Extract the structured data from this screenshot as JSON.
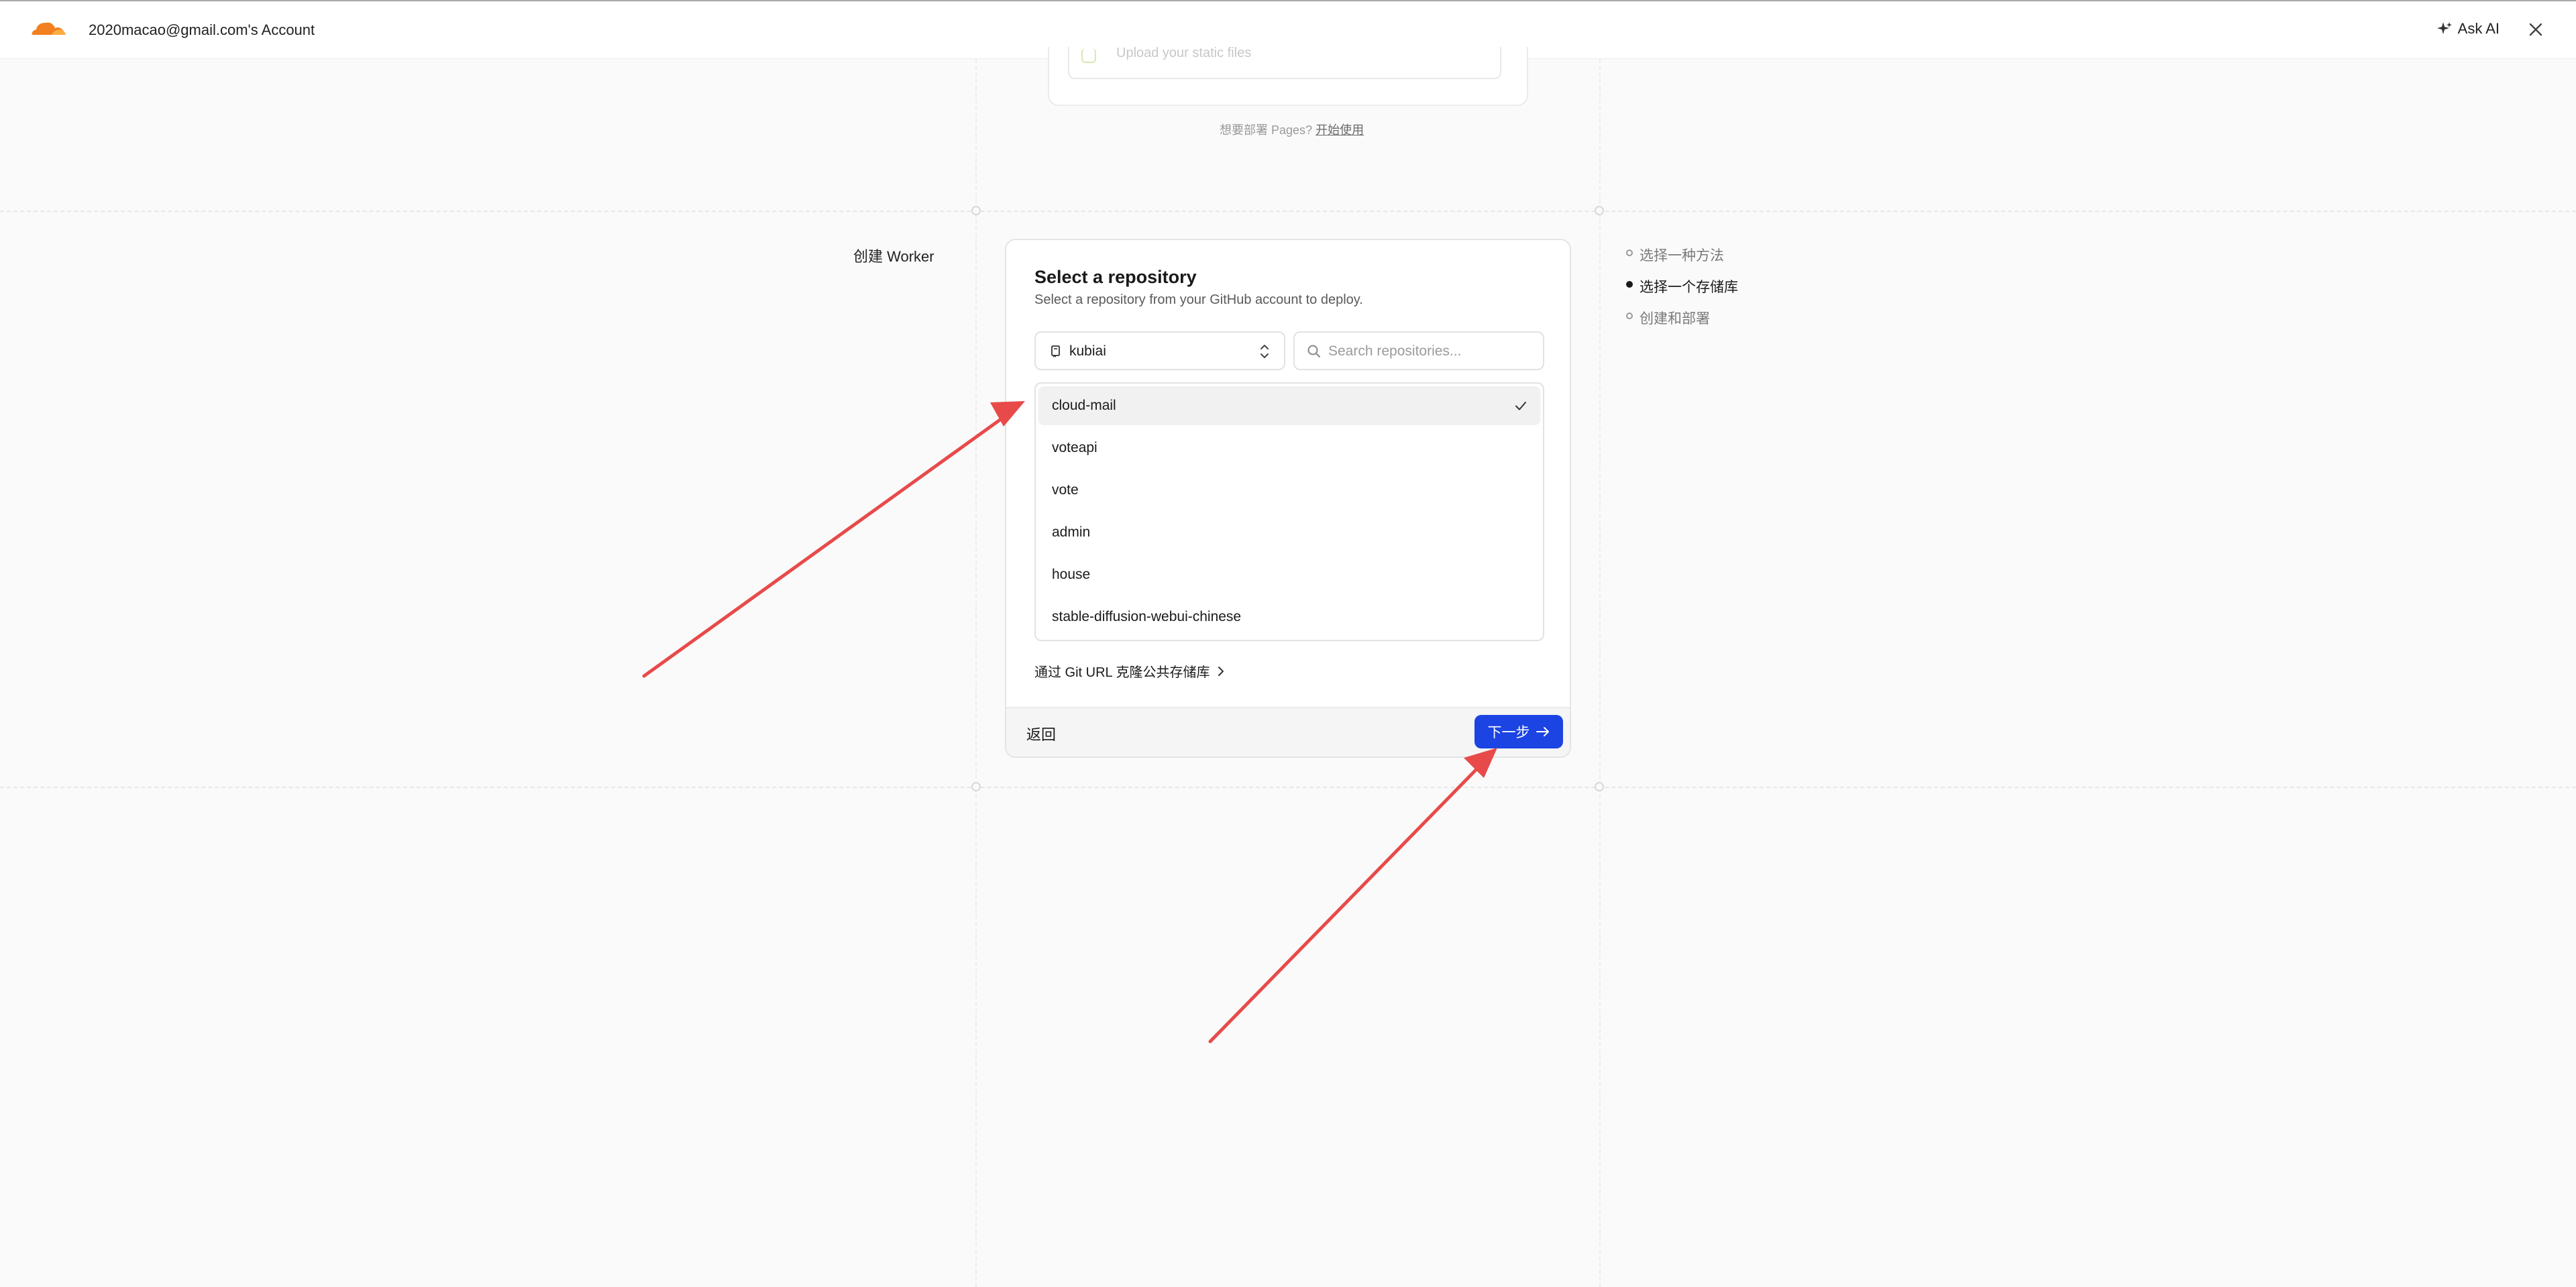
{
  "topbar": {
    "account": "2020macao@gmail.com's Account",
    "ask_ai": "Ask AI"
  },
  "previous_section": {
    "upload_text": "Upload your static files",
    "hint_prefix": "想要部署 Pages?",
    "hint_link": "开始使用"
  },
  "section_title": "创建 Worker",
  "card": {
    "title": "Select a repository",
    "subtitle": "Select a repository from your GitHub account to deploy.",
    "account_select": {
      "value": "kubiai"
    },
    "search": {
      "placeholder": "Search repositories..."
    },
    "repositories": [
      {
        "name": "cloud-mail",
        "selected": true
      },
      {
        "name": "voteapi",
        "selected": false
      },
      {
        "name": "vote",
        "selected": false
      },
      {
        "name": "admin",
        "selected": false
      },
      {
        "name": "house",
        "selected": false
      },
      {
        "name": "stable-diffusion-webui-chinese",
        "selected": false
      }
    ],
    "clone_link": "通过 Git URL 克隆公共存储库",
    "back_label": "返回",
    "next_label": "下一步"
  },
  "steps": [
    {
      "label": "选择一种方法",
      "active": false
    },
    {
      "label": "选择一个存储库",
      "active": true
    },
    {
      "label": "创建和部署",
      "active": false
    }
  ],
  "colors": {
    "accent": "#1c44e3",
    "brand_orange": "#f38020",
    "annotation": "#e84a4a"
  }
}
